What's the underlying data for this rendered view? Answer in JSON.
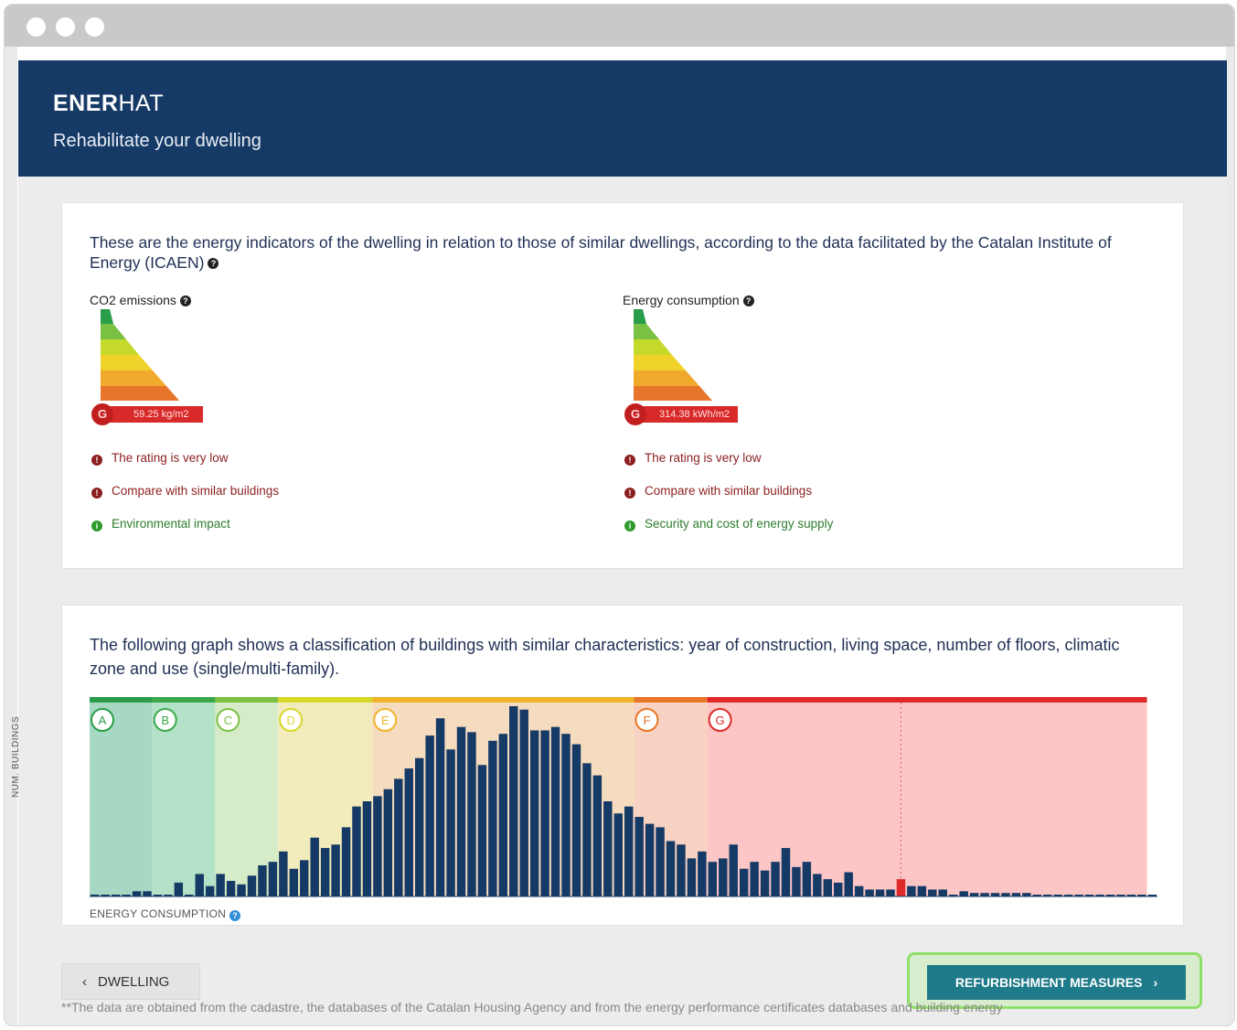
{
  "app": {
    "brand_bold": "ENER",
    "brand_light": "HAT",
    "subtitle": "Rehabilitate your dwelling"
  },
  "indicators": {
    "intro": "These are the energy indicators of the dwelling in relation to those of similar dwellings, according to the data facilitated by the Catalan Institute of Energy (ICAEN)",
    "co2": {
      "title": "CO2 emissions",
      "letter": "G",
      "value": "59.25 kg/m2",
      "messages": [
        {
          "text": "The rating is very low",
          "status": "bad"
        },
        {
          "text": "Compare with similar buildings",
          "status": "bad"
        },
        {
          "text": "Environmental impact",
          "status": "good"
        }
      ]
    },
    "energy": {
      "title": "Energy consumption",
      "letter": "G",
      "value": "314.38 kWh/m2",
      "messages": [
        {
          "text": "The rating is very low",
          "status": "bad"
        },
        {
          "text": "Compare with similar buildings",
          "status": "bad"
        },
        {
          "text": "Security and cost of energy supply",
          "status": "good"
        }
      ]
    }
  },
  "graph": {
    "intro": "The following graph shows a classification of buildings with similar characteristics: year of construction, living space, number of floors, climatic zone and use (single/multi-family).",
    "ylabel": "NUM. BUILDINGS",
    "xlabel": "ENERGY CONSUMPTION"
  },
  "chart_data": {
    "type": "bar",
    "xlabel": "ENERGY CONSUMPTION",
    "ylabel": "NUM. BUILDINGS",
    "bands": [
      {
        "label": "A",
        "color": "#a6d8c3",
        "top": "#2a9d4a",
        "from": 0,
        "to": 6
      },
      {
        "label": "B",
        "color": "#b4e2c8",
        "top": "#3aa84a",
        "from": 6,
        "to": 12
      },
      {
        "label": "C",
        "color": "#d6ecc8",
        "top": "#7ac043",
        "from": 12,
        "to": 18
      },
      {
        "label": "D",
        "color": "#f2ecbc",
        "top": "#d9d62a",
        "from": 18,
        "to": 27
      },
      {
        "label": "E",
        "color": "#f6dcbf",
        "top": "#f0b32a",
        "from": 27,
        "to": 52
      },
      {
        "label": "F",
        "color": "#f8d2c2",
        "top": "#e8762a",
        "from": 52,
        "to": 59
      },
      {
        "label": "G",
        "color": "#fcc6c6",
        "top": "#e02a2a",
        "from": 59,
        "to": 101
      }
    ],
    "highlight_index": 77,
    "values": [
      1,
      1,
      1,
      1,
      3,
      3,
      1,
      1,
      8,
      1,
      13,
      6,
      13,
      9,
      7,
      12,
      18,
      20,
      26,
      16,
      21,
      34,
      28,
      30,
      40,
      52,
      55,
      58,
      62,
      68,
      74,
      80,
      93,
      103,
      85,
      98,
      95,
      76,
      90,
      94,
      110,
      108,
      96,
      96,
      98,
      94,
      88,
      77,
      70,
      55,
      48,
      52,
      46,
      42,
      40,
      32,
      30,
      22,
      26,
      20,
      22,
      30,
      16,
      20,
      15,
      20,
      28,
      17,
      20,
      13,
      10,
      8,
      14,
      6,
      4,
      4,
      4,
      10,
      6,
      6,
      4,
      4,
      1,
      3,
      2,
      2,
      2,
      2,
      2,
      2,
      1,
      1,
      1,
      1,
      0,
      0,
      0,
      0,
      0,
      0,
      0,
      0
    ],
    "ylim": [
      0,
      110
    ]
  },
  "nav": {
    "back_label": "DWELLING",
    "next_label": "REFURBISHMENT MEASURES"
  },
  "footnote": "**The data are obtained from the cadastre, the databases of the Catalan Housing Agency and from the energy performance certificates databases and building energy"
}
